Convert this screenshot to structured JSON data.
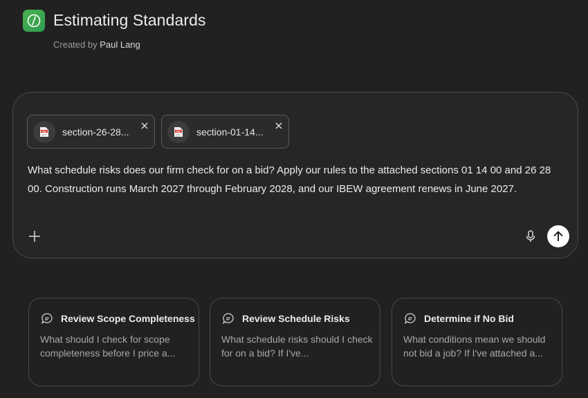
{
  "gpt": {
    "title": "Estimating Standards",
    "created_by_prefix": "Created by",
    "author": "Paul Lang",
    "accent_color": "#3fa556"
  },
  "composer": {
    "attachments": [
      {
        "name": "section-26-28...",
        "type": "PDF"
      },
      {
        "name": "section-01-14...",
        "type": "PDF"
      }
    ],
    "prompt": "What schedule risks does our firm check for on a bid? Apply our rules to the attached sections 01 14 00 and 26 28 00. Construction runs March 2027 through February 2028, and our IBEW agreement renews in June 2027.",
    "icons": {
      "add": "plus-icon",
      "voice": "microphone-icon",
      "send": "arrow-up-icon"
    }
  },
  "suggestions": [
    {
      "title": "Review Scope Completeness",
      "body": "What should I check for scope completeness before I price a..."
    },
    {
      "title": "Review Schedule Risks",
      "body": "What schedule risks should I check for on a bid? If I've..."
    },
    {
      "title": "Determine if No Bid",
      "body": "What conditions mean we should not bid a job? If I've attached a..."
    }
  ]
}
